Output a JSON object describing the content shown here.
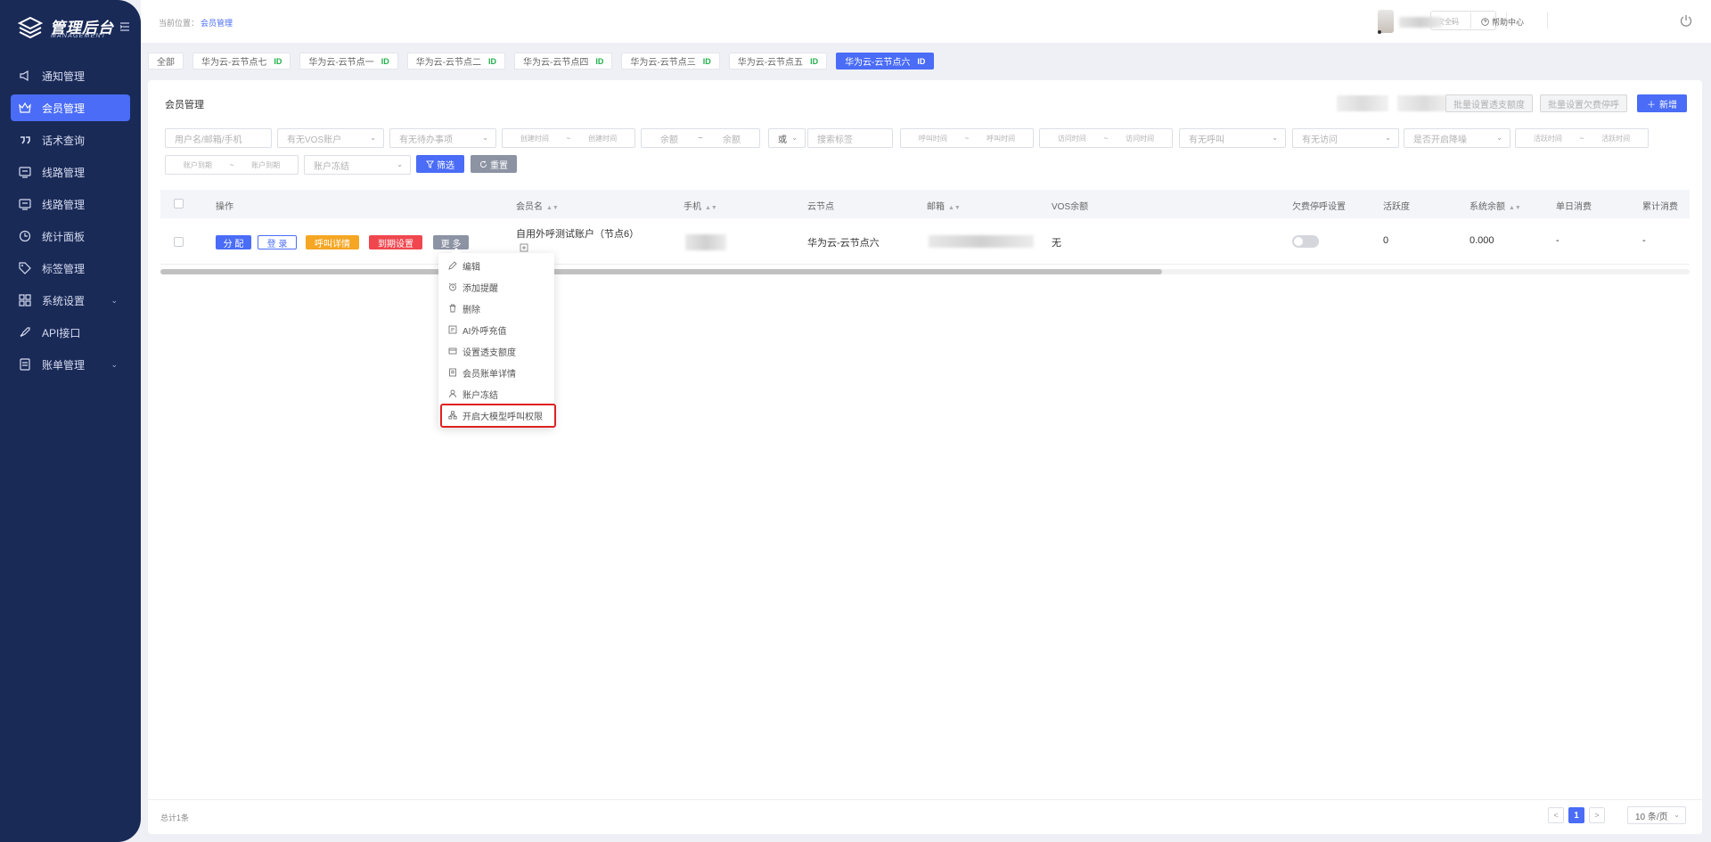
{
  "brand": {
    "title": "管理后台",
    "subtitle": "MANAGEMENT"
  },
  "sidebar": {
    "items": [
      {
        "label": "通知管理",
        "icon": "megaphone-icon",
        "active": false
      },
      {
        "label": "会员管理",
        "icon": "crown-icon",
        "active": true
      },
      {
        "label": "话术查询",
        "icon": "quote-icon",
        "active": false
      },
      {
        "label": "线路管理",
        "icon": "route-icon",
        "active": false,
        "badge": ""
      },
      {
        "label": "线路管理",
        "icon": "route-icon",
        "active": false
      },
      {
        "label": "统计面板",
        "icon": "clock-icon",
        "active": false
      },
      {
        "label": "标签管理",
        "icon": "tag-icon",
        "active": false
      },
      {
        "label": "系统设置",
        "icon": "grid-icon",
        "active": false,
        "expandable": true
      },
      {
        "label": "API接口",
        "icon": "rocket-icon",
        "active": false
      },
      {
        "label": "账单管理",
        "icon": "bill-icon",
        "active": false,
        "expandable": true
      }
    ]
  },
  "topbar": {
    "breadcrumb_label": "当前位置：",
    "breadcrumb_current": "会员管理",
    "security_placeholder": "安全码",
    "help_label": "帮助中心"
  },
  "tabs": [
    {
      "label": "全部",
      "id_badge": "",
      "active": false
    },
    {
      "label": "华为云-云节点七",
      "id_badge": "ID",
      "active": false
    },
    {
      "label": "华为云-云节点一",
      "id_badge": "ID",
      "active": false
    },
    {
      "label": "华为云-云节点二",
      "id_badge": "ID",
      "active": false
    },
    {
      "label": "华为云-云节点四",
      "id_badge": "ID",
      "active": false
    },
    {
      "label": "华为云-云节点三",
      "id_badge": "ID",
      "active": false
    },
    {
      "label": "华为云-云节点五",
      "id_badge": "ID",
      "active": false
    },
    {
      "label": "华为云-云节点六",
      "id_badge": "ID",
      "active": true
    }
  ],
  "panel": {
    "title": "会员管理",
    "batch_overdraft_label": "批量设置透支额度",
    "batch_stop_label": "批量设置欠费停呼",
    "add_label": "新增"
  },
  "filters": {
    "user_placeholder": "用户名/邮箱/手机",
    "vos_account": "有无VOS账户",
    "todo": "有无待办事项",
    "created_from": "创建时间",
    "created_to": "创建时间",
    "balance_from": "余额",
    "balance_to": "余额",
    "logic": "或",
    "tag_placeholder": "搜索标签",
    "call_from": "呼叫时间",
    "call_to": "呼叫时间",
    "visit_from": "访问时间",
    "visit_to": "访问时间",
    "has_call": "有无呼叫",
    "has_visit": "有无访问",
    "degrade": "是否开启降噪",
    "active_from": "活跃时间",
    "active_to": "活跃时间",
    "expire_from": "账户到期",
    "expire_to": "账户到期",
    "frozen": "账户冻结",
    "filter_label": "筛选",
    "reset_label": "重置",
    "range_sep": "~"
  },
  "table": {
    "headers": {
      "ops": "操作",
      "member": "会员名",
      "phone": "手机",
      "node": "云节点",
      "email": "邮箱",
      "vos_balance": "VOS余额",
      "overdue_stop": "欠费停呼设置",
      "activity": "活跃度",
      "sys_balance": "系统余额",
      "daily_cost": "单日消费",
      "total_cost": "累计消费"
    },
    "row": {
      "op_assign": "分 配",
      "op_login": "登 录",
      "op_call": "呼叫详情",
      "op_expire": "到期设置",
      "op_more": "更 多",
      "member": "自用外呼测试账户（节点6）",
      "node": "华为云-云节点六",
      "vos_balance": "无",
      "overdue_stop_on": false,
      "activity": "0",
      "sys_balance": "0.000",
      "daily_cost": "-",
      "total_cost": "-"
    },
    "horizontal_scroll_fraction": 0.655
  },
  "more_menu": [
    {
      "label": "编辑",
      "icon": "edit-icon"
    },
    {
      "label": "添加提醒",
      "icon": "alarm-icon"
    },
    {
      "label": "删除",
      "icon": "trash-icon"
    },
    {
      "label": "AI外呼充值",
      "icon": "recharge-icon"
    },
    {
      "label": "设置透支额度",
      "icon": "overdraft-icon"
    },
    {
      "label": "会员账单详情",
      "icon": "bill-detail-icon"
    },
    {
      "label": "账户冻结",
      "icon": "user-freeze-icon"
    },
    {
      "label": "开启大模型呼叫权限",
      "icon": "model-permission-icon",
      "highlighted": true
    }
  ],
  "footer": {
    "total": "总计1条",
    "prev": "<",
    "next": ">",
    "current_page": "1",
    "page_size": "10 条/页"
  },
  "colors": {
    "primary": "#4a6cf7",
    "sidebar": "#1a2a57",
    "warning": "#f5a623",
    "danger": "#f0474f",
    "highlight": "#e02020"
  }
}
